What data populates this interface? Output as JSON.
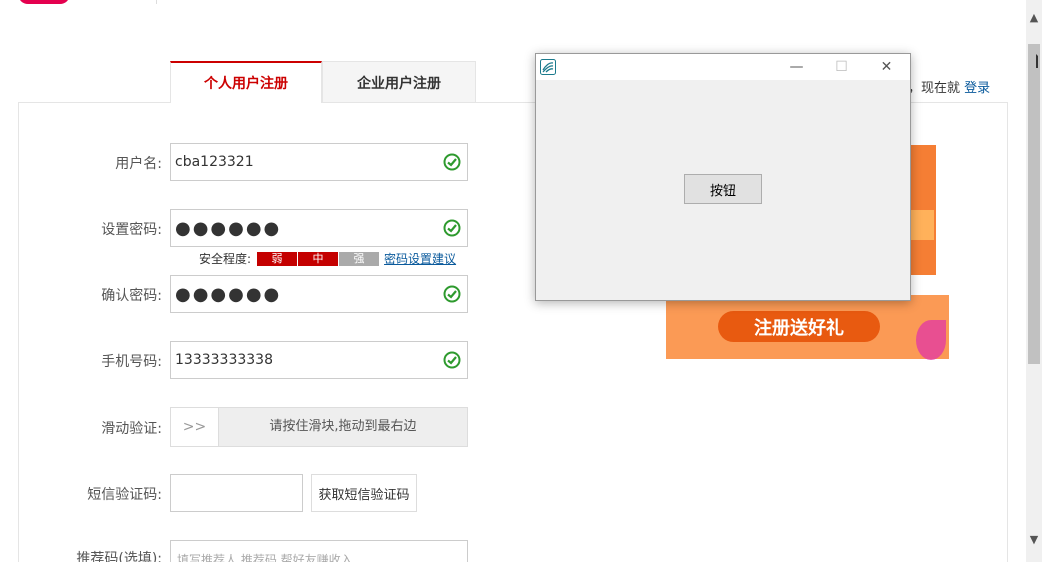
{
  "tabs": [
    {
      "label": "个人用户注册",
      "active": true
    },
    {
      "label": "企业用户注册",
      "active": false
    }
  ],
  "login_hint": {
    "text": "，现在就",
    "link": "登录"
  },
  "form": {
    "username": {
      "label": "用户名:",
      "value": "cba123321"
    },
    "password": {
      "label": "设置密码:",
      "value": "●●●●●●"
    },
    "strength": {
      "label": "安全程度:",
      "levels": [
        "弱",
        "中",
        "强"
      ],
      "advice": "密码设置建议"
    },
    "confirm": {
      "label": "确认密码:",
      "value": "●●●●●●"
    },
    "phone": {
      "label": "手机号码:",
      "value": "13333333338"
    },
    "slider": {
      "label": "滑动验证:",
      "handle": ">>",
      "text": "请按住滑块,拖动到最右边"
    },
    "sms": {
      "label": "短信验证码:",
      "button": "获取短信验证码"
    },
    "referral": {
      "label": "推荐码(选填):",
      "placeholder": "填写推荐人 推荐码 帮好友赚收入"
    }
  },
  "promo": {
    "button": "注册送好礼"
  },
  "dialog": {
    "button": "按钮",
    "minimize": "—",
    "maximize": "☐",
    "close": "✕"
  },
  "colors": {
    "accent": "#cc0000",
    "link": "#0a5a9c",
    "check": "#2e9a2e"
  }
}
